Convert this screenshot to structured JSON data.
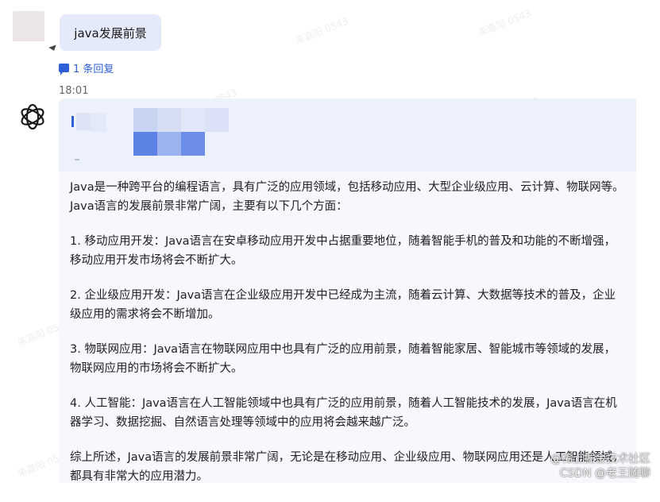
{
  "user_message": {
    "text": "java发展前景"
  },
  "replies": {
    "label": "1 条回复",
    "icon": "comment-icon"
  },
  "timestamp": "18:01",
  "bot": {
    "icon": "openai-logo-icon"
  },
  "answer": {
    "paragraphs": [
      "Java是一种跨平台的编程语言，具有广泛的应用领域，包括移动应用、大型企业级应用、云计算、物联网等。Java语言的发展前景非常广阔，主要有以下几个方面：",
      "1. 移动应用开发：Java语言在安卓移动应用开发中占据重要地位，随着智能手机的普及和功能的不断增强，移动应用开发市场将会不断扩大。",
      "2. 企业级应用开发：Java语言在企业级应用开发中已经成为主流，随着云计算、大数据等技术的普及，企业级应用的需求将会不断增加。",
      "3. 物联网应用：Java语言在物联网应用中也具有广泛的应用前景，随着智能家居、智能城市等领域的发展，物联网应用的市场将会不断扩大。",
      "4. 人工智能：Java语言在人工智能领域中也具有广泛的应用前景，随着人工智能技术的发展，Java语言在机器学习、数据挖掘、自然语言处理等领域中的应用将会越来越广泛。",
      "综上所述，Java语言的发展前景非常广阔，无论是在移动应用、企业级应用、物联网应用还是人工智能领域，都具有非常大的应用潜力。"
    ]
  },
  "watermark_text": "朱嘉阳 0543",
  "csdn_watermark": {
    "line1": "@稀土掘金技术社区",
    "line2": "CSDN @老王随聊"
  },
  "colors": {
    "accent": "#2f5fd6",
    "bubble": "#e5eafb",
    "card": "#f7f8fc"
  }
}
